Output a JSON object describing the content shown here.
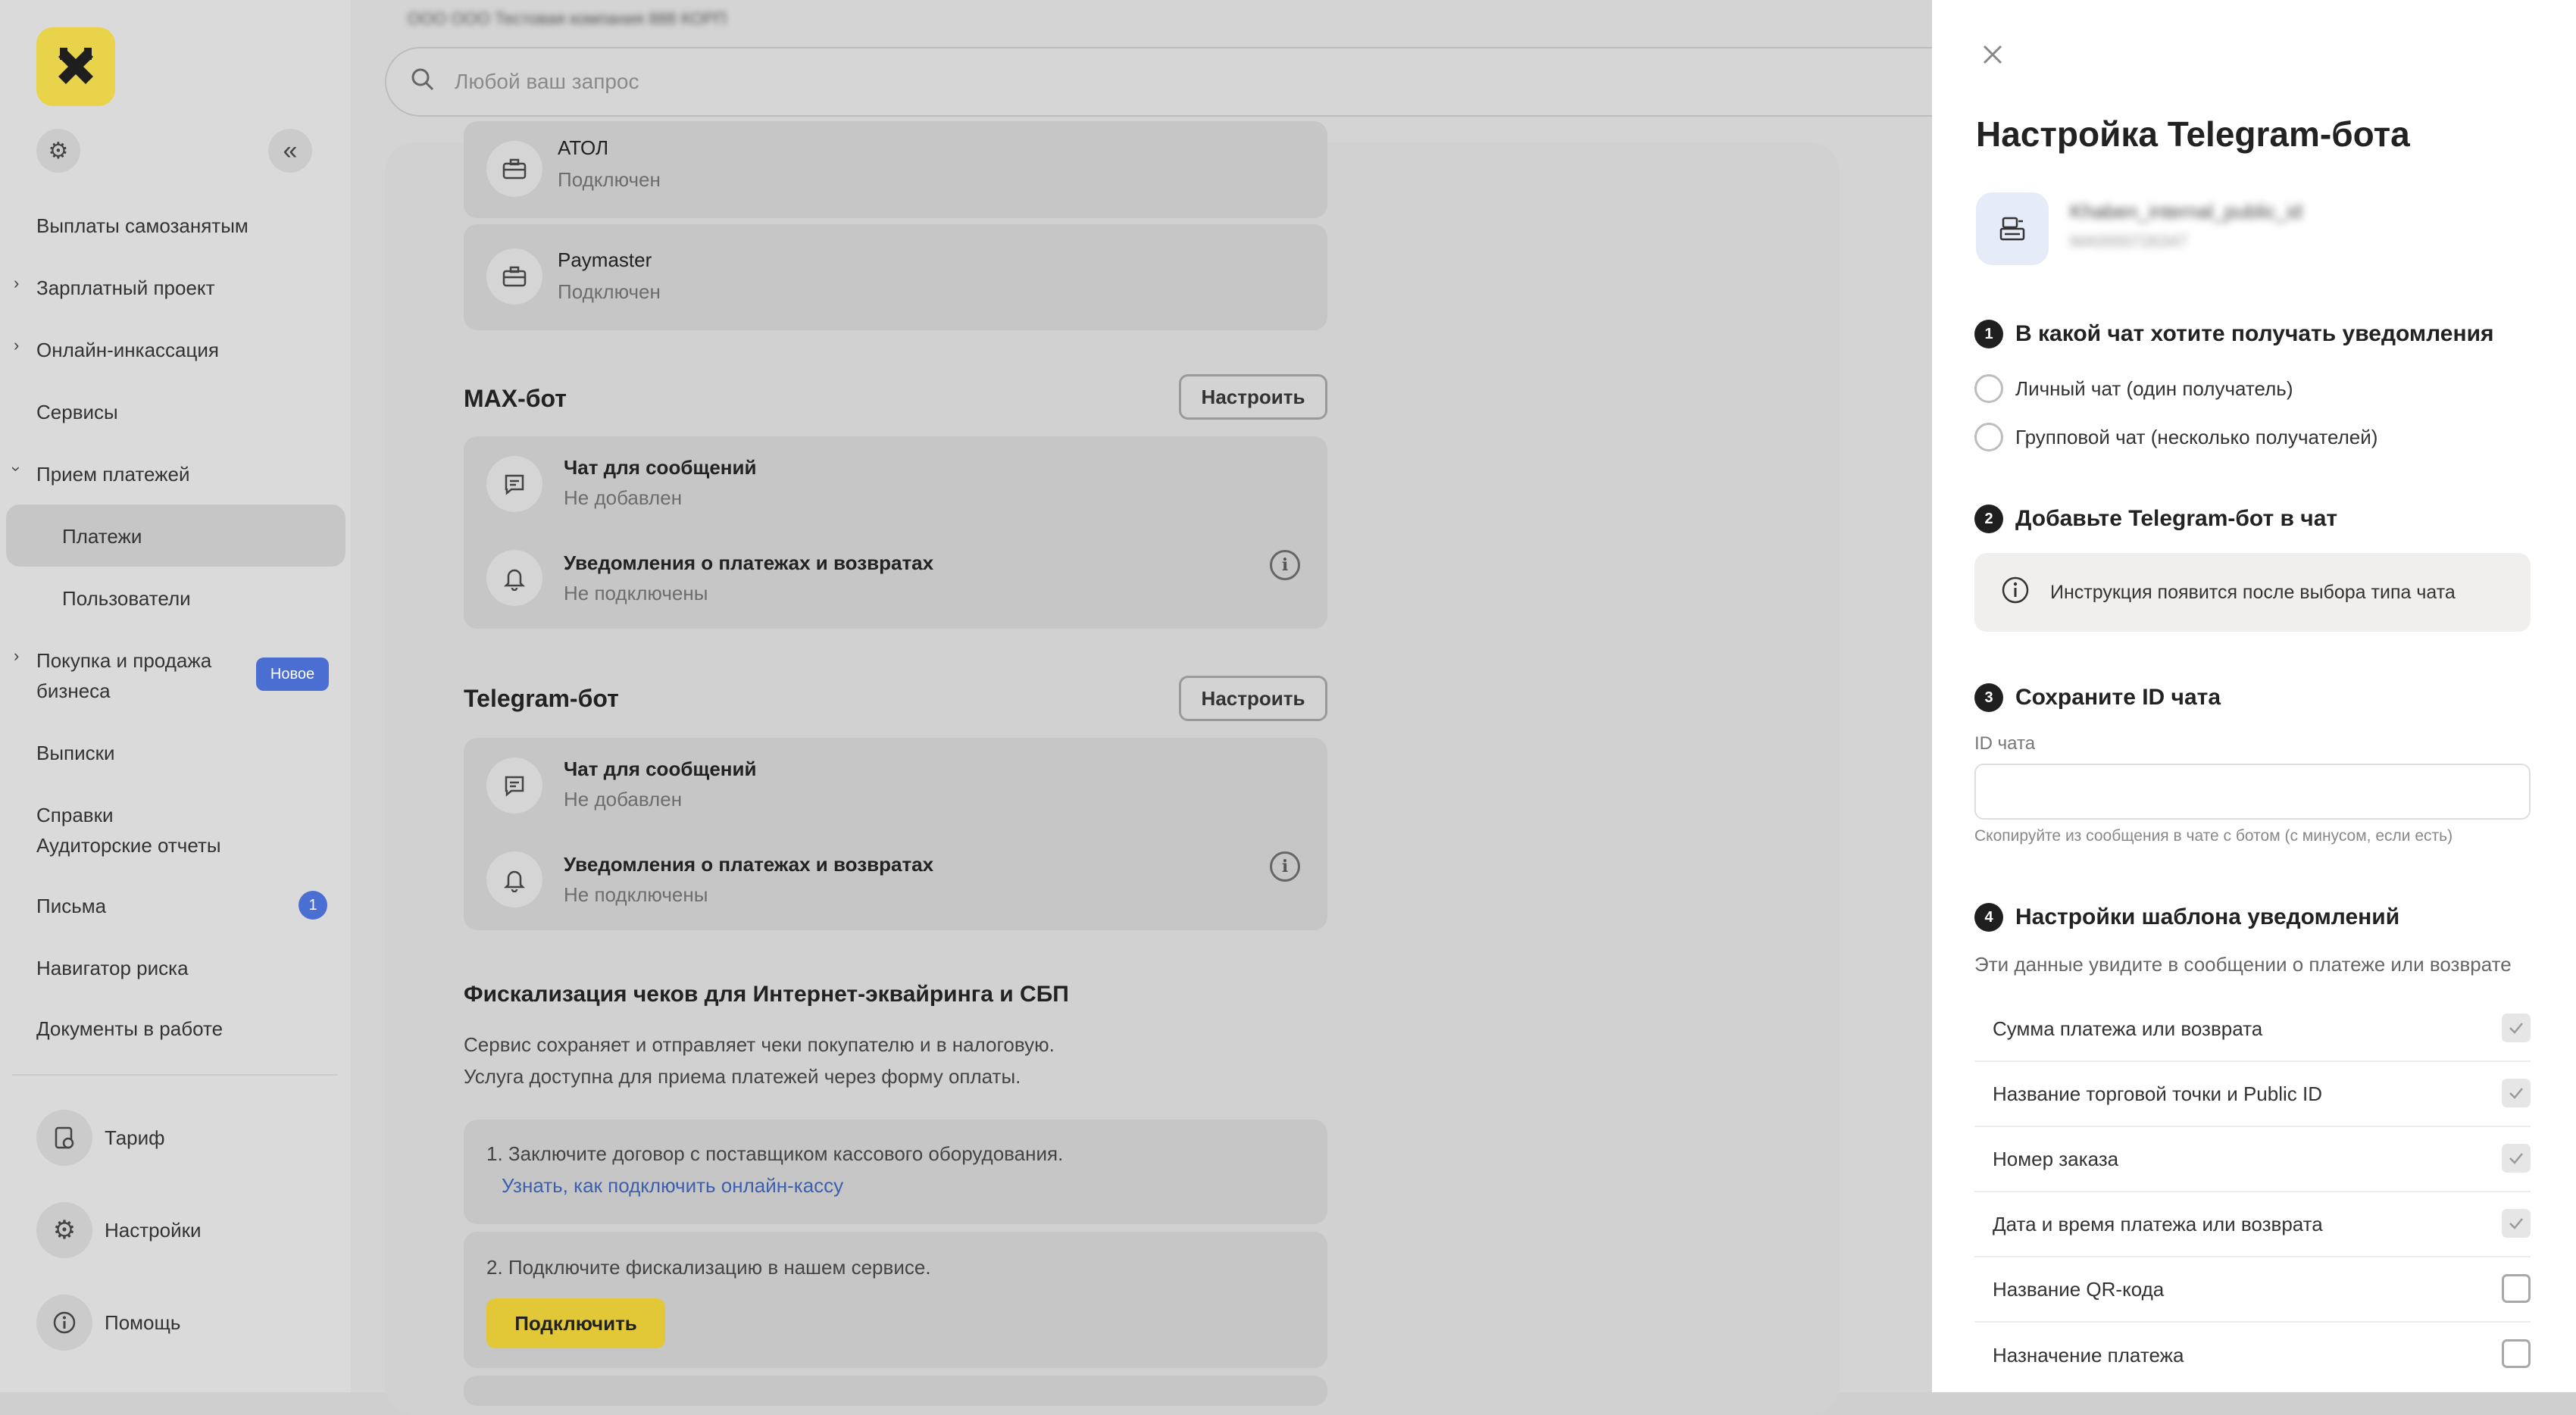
{
  "sidebar": {
    "items": [
      {
        "label": "Выплаты самозанятым"
      },
      {
        "label": "Зарплатный проект"
      },
      {
        "label": "Онлайн-инкассация"
      },
      {
        "label": "Сервисы"
      },
      {
        "label": "Прием платежей"
      },
      {
        "label": "Платежи"
      },
      {
        "label": "Пользователи"
      },
      {
        "label": "Покупка и продажа",
        "label2": "бизнеса",
        "badge": "Новое"
      },
      {
        "label": "Выписки"
      },
      {
        "label": "Справки",
        "label2": "Аудиторские отчеты"
      },
      {
        "label": "Письма",
        "badge": "1"
      },
      {
        "label": "Навигатор риска"
      },
      {
        "label": "Документы в работе"
      }
    ],
    "bottom": [
      {
        "label": "Тариф",
        "icon": "tariff-icon"
      },
      {
        "label": "Настройки",
        "icon": "gear-icon"
      },
      {
        "label": "Помощь",
        "icon": "help-icon"
      }
    ]
  },
  "header": {
    "breadcrumb": "ООО ООО Тестовая компания 888 КОРП",
    "search_placeholder": "Любой ваш запрос"
  },
  "main": {
    "kassa_cards": [
      {
        "name": "АТОЛ",
        "status": "Подключен"
      },
      {
        "name": "Paymaster",
        "status": "Подключен"
      }
    ],
    "max_bot": {
      "title": "MAX-бот",
      "button": "Настроить",
      "chat_title": "Чат для сообщений",
      "chat_status": "Не добавлен",
      "notif_title": "Уведомления о платежах и возвратах",
      "notif_status": "Не подключены"
    },
    "telegram_bot": {
      "title": "Telegram-бот",
      "button": "Настроить",
      "chat_title": "Чат для сообщений",
      "chat_status": "Не добавлен",
      "notif_title": "Уведомления о платежах и возвратах",
      "notif_status": "Не подключены"
    },
    "fiscal": {
      "title": "Фискализация чеков для Интернет-эквайринга и СБП",
      "desc1": "Сервис сохраняет и отправляет чеки покупателю и в налоговую.",
      "desc2": "Услуга доступна для приема платежей через форму оплаты.",
      "step1": "1. Заключите договор с поставщиком кассового оборудования.",
      "step1_link": "Узнать, как подключить онлайн-кассу",
      "step2": "2. Подключите фискализацию в нашем сервисе.",
      "connect_button": "Подключить"
    }
  },
  "drawer": {
    "title": "Настройка Telegram-бота",
    "account_name": "Khaben_internal_public_id",
    "account_id": "MA0000726347",
    "step1": {
      "num": "1",
      "title": "В какой чат хотите получать уведомления"
    },
    "radio_options": [
      "Личный чат (один получатель)",
      "Групповой чат (несколько получателей)"
    ],
    "step2": {
      "num": "2",
      "title": "Добавьте Telegram-бот в чат"
    },
    "hint": "Инструкция появится после выбора типа чата",
    "step3": {
      "num": "3",
      "title": "Сохраните ID чата"
    },
    "chat_id_label": "ID чата",
    "chat_id_value": "",
    "chat_id_help": "Скопируйте из сообщения в чате с ботом (с минусом, если есть)",
    "step4": {
      "num": "4",
      "title": "Настройки шаблона уведомлений"
    },
    "template_desc": "Эти данные увидите в сообщении о платеже или возврате",
    "template_options": [
      {
        "label": "Сумма платежа или возврата",
        "checked": true
      },
      {
        "label": "Название торговой точки и Public ID",
        "checked": true
      },
      {
        "label": "Номер заказа",
        "checked": true
      },
      {
        "label": "Дата и время платежа или возврата",
        "checked": true
      },
      {
        "label": "Название QR-кода",
        "checked": false
      },
      {
        "label": "Назначение платежа",
        "checked": false
      }
    ]
  },
  "colors": {
    "brand_yellow": "#e8d34a",
    "badge_blue": "#4b6ed2",
    "link_blue": "#3c5fae"
  }
}
